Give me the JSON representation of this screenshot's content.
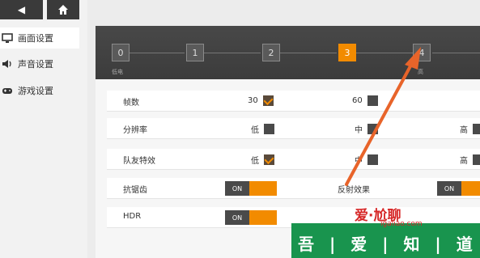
{
  "sidebar": {
    "items": [
      {
        "label": "画面设置",
        "icon": "monitor-icon",
        "active": true
      },
      {
        "label": "声音设置",
        "icon": "speaker-icon",
        "active": false
      },
      {
        "label": "游戏设置",
        "icon": "gamepad-icon",
        "active": false
      }
    ]
  },
  "quality": {
    "levels": [
      "0",
      "1",
      "2",
      "3",
      "4"
    ],
    "selected": "3",
    "caption_left": "低电",
    "caption_right": "高"
  },
  "settings": {
    "fps": {
      "label": "帧数",
      "opt1": "30",
      "opt2": "60"
    },
    "resolution": {
      "label": "分辨率",
      "opt1": "低",
      "opt2": "中",
      "opt3": "高"
    },
    "teammate_fx": {
      "label": "队友特效",
      "opt1": "低",
      "opt2": "中",
      "opt3": "高"
    },
    "antialias": {
      "label": "抗锯齿",
      "toggle": "ON"
    },
    "reflection": {
      "label": "反射效果",
      "toggle": "ON"
    },
    "hdr": {
      "label": "HDR",
      "toggle": "ON"
    }
  },
  "watermark": {
    "text": "吾 | 爱 | 知 | 道",
    "logo": "爱·尬聊",
    "url": "igaliao.com"
  },
  "colors": {
    "accent": "#f28b00",
    "watermark_green": "#19944e",
    "arrow": "#e8642a"
  }
}
